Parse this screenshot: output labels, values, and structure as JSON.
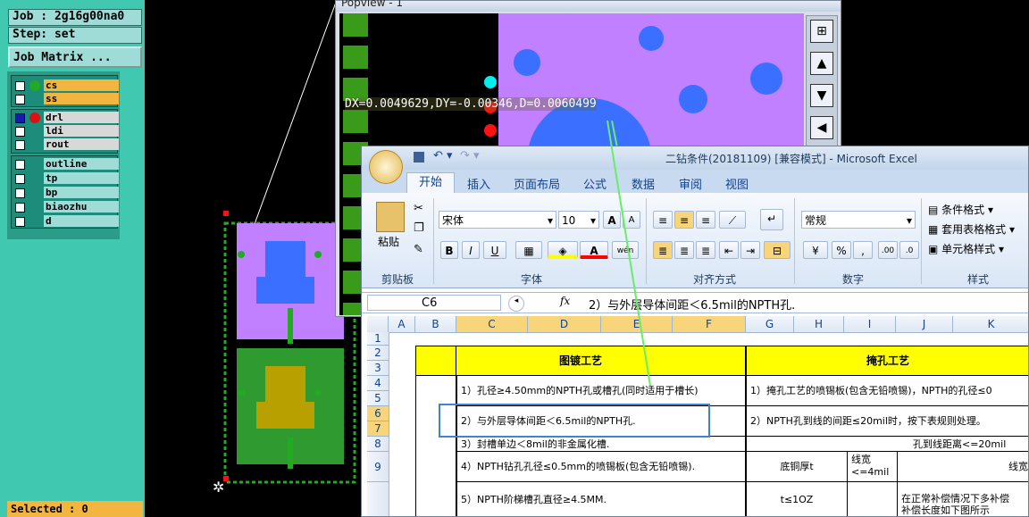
{
  "cam": {
    "job_label": "Job : 2g16g00na0",
    "step_label": "Step: set",
    "job_matrix_button": "Job Matrix ...",
    "layers_group1": [
      {
        "name": "cs",
        "dot_color": "#22aa22",
        "bg": "#f2b640"
      },
      {
        "name": "ss",
        "dot_color": "",
        "bg": "#f2b640"
      }
    ],
    "layers_group2": [
      {
        "name": "drl",
        "dot_color": "#dd1111",
        "bg": "#d8d8d8"
      },
      {
        "name": "ldi",
        "dot_color": "",
        "bg": "#d8d8d8"
      },
      {
        "name": "rout",
        "dot_color": "",
        "bg": "#d8d8d8"
      }
    ],
    "layers_group3": [
      {
        "name": "outline",
        "dot_color": "",
        "bg": "#9fdcd8"
      },
      {
        "name": "tp",
        "dot_color": "",
        "bg": "#9fdcd8"
      },
      {
        "name": "bp",
        "dot_color": "",
        "bg": "#9fdcd8"
      },
      {
        "name": "biaozhu",
        "dot_color": "",
        "bg": "#9fdcd8"
      },
      {
        "name": "d",
        "dot_color": "",
        "bg": "#9fdcd8"
      }
    ],
    "selected_label": "Selected : 0"
  },
  "popview": {
    "title": "Popview - 1",
    "measure_text": "DX=0.0049629,DY=-0.00346,D=0.0060499",
    "side_buttons": [
      "zoom-in-icon",
      "zoom-top-icon",
      "zoom-bottom-icon",
      "zoom-left-icon"
    ]
  },
  "excel": {
    "title": "二钻条件(20181109)  [兼容模式] - Microsoft Excel",
    "tabs": [
      "开始",
      "插入",
      "页面布局",
      "公式",
      "数据",
      "审阅",
      "视图"
    ],
    "active_tab": "开始",
    "clipboard": {
      "paste_label": "粘贴",
      "group_label": "剪贴板"
    },
    "font": {
      "name": "宋体",
      "size": "10",
      "bold": "B",
      "italic": "I",
      "underline": "U",
      "grow": "A",
      "shrink": "A",
      "wen": "wén",
      "group_label": "字体",
      "fill_color": "#ffff00",
      "font_color": "#ff0000"
    },
    "alignment": {
      "group_label": "对齐方式"
    },
    "number": {
      "format": "常规",
      "percent": "%",
      "comma": ",",
      "inc": ".00",
      "dec": ".0",
      "group_label": "数字"
    },
    "styles": {
      "cond_format": "条件格式",
      "table_format": "套用表格格式",
      "cell_style": "单元格样式",
      "group_label": "样式"
    },
    "name_box": "C6",
    "formula": "2）与外层导体间距＜6.5mil的NPTH孔.",
    "fx": "fx",
    "columns": [
      "A",
      "B",
      "C",
      "D",
      "E",
      "F",
      "G",
      "H",
      "I",
      "J",
      "K"
    ],
    "rows": [
      "1",
      "2",
      "3",
      "4",
      "5",
      "6",
      "7",
      "8",
      "9"
    ],
    "cells": {
      "header_plating": "图镀工艺",
      "header_masking": "掩孔工艺",
      "r1": "1）孔径≥4.50mm的NPTH孔或槽孔(同时适用于槽长)",
      "r2": "2）与外层导体间距＜6.5mil的NPTH孔.",
      "r3": "3）封槽单边＜8mil的非金属化槽.",
      "r4": "4）NPTH钻孔孔径≤0.5mm的喷锡板(包含无铅喷锡).",
      "r5": "5）NPTH阶梯槽孔直径≥4.5MM.",
      "m1": "1）掩孔工艺的喷锡板(包含无铅喷锡)，NPTH的孔径≤0",
      "m2": "2）NPTH孔到线的间距≤20mil时，按下表规则处理。",
      "m3": "孔到线距离<=20mil",
      "m4_a": "底铜厚t",
      "m4_b": "线宽",
      "m4_c": "<=4mil",
      "m4_d": "线宽",
      "m5_a": "t≤1OZ",
      "m5_b": "在正常补偿情况下多补偿",
      "m5_c": "补偿长度如下图所示"
    }
  }
}
